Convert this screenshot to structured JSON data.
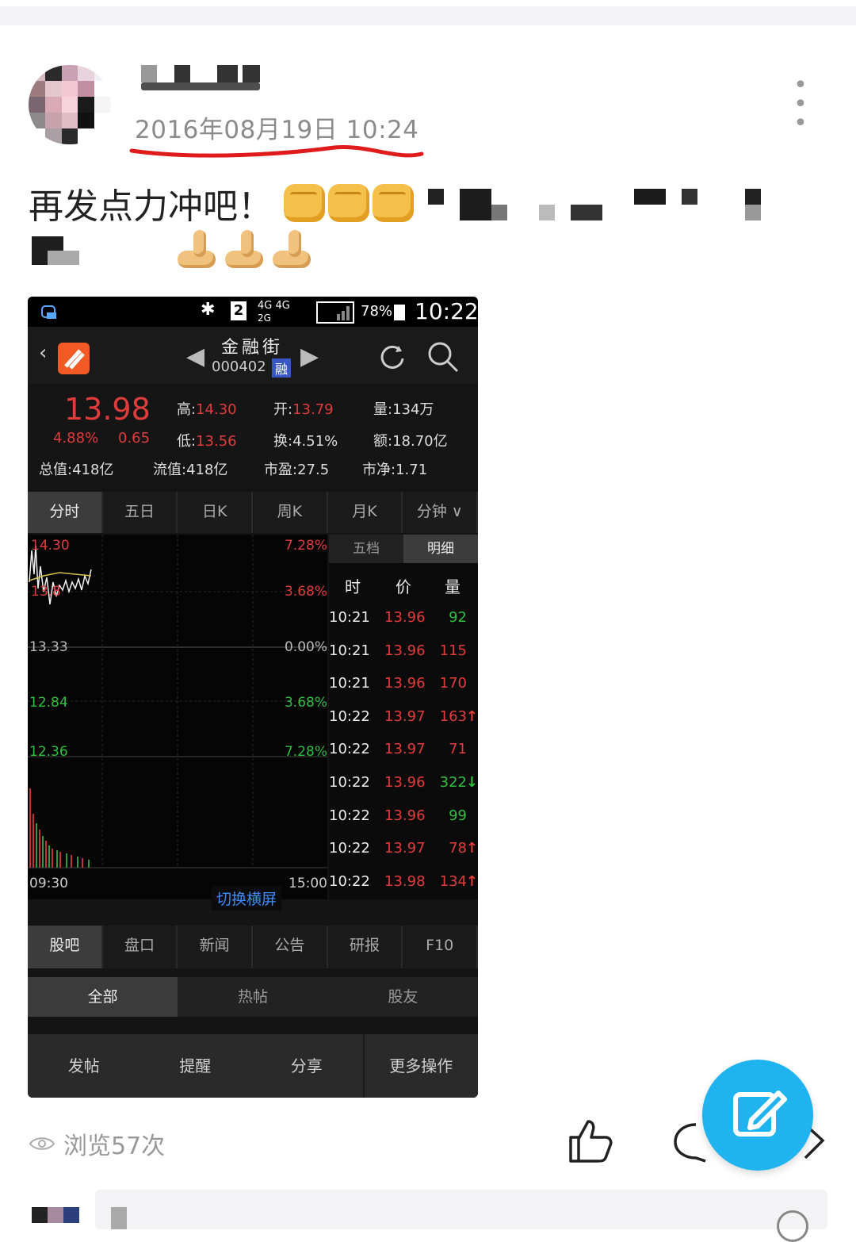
{
  "post": {
    "date": "2016年08月19日 10:24",
    "more": "• • •",
    "text": "再发点力冲吧！",
    "views": "浏览57次"
  },
  "stock_app": {
    "status": {
      "network": "4G 4G",
      "signal2": "2G",
      "battery": "78%",
      "time": "10:22",
      "sim": "2"
    },
    "header": {
      "name": "金融街",
      "code": "000402",
      "badge": "融"
    },
    "quote": {
      "price": "13.98",
      "pct": "4.88%",
      "change": "0.65",
      "high_label": "高:",
      "high": "14.30",
      "open_label": "开:",
      "open": "13.79",
      "vol_label": "量:",
      "vol": "134万",
      "low_label": "低:",
      "low": "13.56",
      "turnover_label": "换:",
      "turnover": "4.51%",
      "amount_label": "额:",
      "amount": "18.70亿",
      "mktcap_label": "总值:",
      "mktcap": "418亿",
      "float_label": "流值:",
      "float": "418亿",
      "pe_label": "市盈:",
      "pe": "27.5",
      "pb_label": "市净:",
      "pb": "1.71"
    },
    "tabs": [
      "分时",
      "五日",
      "日K",
      "周K",
      "月K",
      "分钟"
    ],
    "chart": {
      "left_labels": [
        "14.30",
        "13.8",
        "13.33",
        "12.84",
        "12.36"
      ],
      "right_labels": [
        "7.28%",
        "3.68%",
        "0.00%",
        "3.68%",
        "7.28%"
      ],
      "time_start": "09:30",
      "time_end": "15:00",
      "switch": "切换横屏"
    },
    "detail": {
      "tabs": [
        "五档",
        "明细"
      ],
      "headers": [
        "时",
        "价",
        "量"
      ],
      "rows": [
        {
          "t": "10:21",
          "p": "13.96",
          "v": "92",
          "c": "green"
        },
        {
          "t": "10:21",
          "p": "13.96",
          "v": "115",
          "c": "red"
        },
        {
          "t": "10:21",
          "p": "13.96",
          "v": "170",
          "c": "red"
        },
        {
          "t": "10:22",
          "p": "13.97",
          "v": "163",
          "c": "red",
          "arrow": "up"
        },
        {
          "t": "10:22",
          "p": "13.97",
          "v": "71",
          "c": "red"
        },
        {
          "t": "10:22",
          "p": "13.96",
          "v": "322",
          "c": "green",
          "arrow": "down"
        },
        {
          "t": "10:22",
          "p": "13.96",
          "v": "99",
          "c": "green"
        },
        {
          "t": "10:22",
          "p": "13.97",
          "v": "78",
          "c": "red",
          "arrow": "up"
        },
        {
          "t": "10:22",
          "p": "13.98",
          "v": "134",
          "c": "red",
          "arrow": "up"
        }
      ]
    },
    "tabs2": [
      "股吧",
      "盘口",
      "新闻",
      "公告",
      "研报",
      "F10"
    ],
    "tabs3": [
      "全部",
      "热帖",
      "股友"
    ],
    "bottom": [
      "发帖",
      "提醒",
      "分享",
      "更多操作"
    ]
  },
  "colors": {
    "accent": "#1fb3f0",
    "red": "#e03c3c",
    "green": "#2fbf3f",
    "underline": "#e01b1b"
  }
}
